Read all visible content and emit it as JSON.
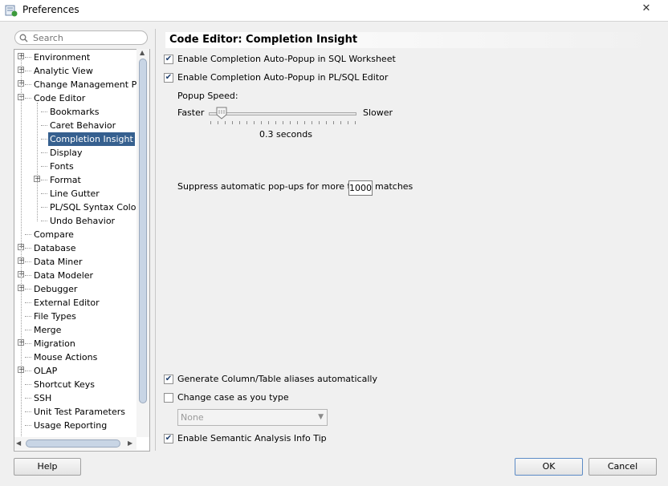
{
  "window": {
    "title": "Preferences",
    "close_label": "✕"
  },
  "search": {
    "placeholder": "Search"
  },
  "tree": {
    "items": [
      {
        "label": "Environment",
        "expandable": true,
        "level": 0
      },
      {
        "label": "Analytic View",
        "expandable": true,
        "level": 0
      },
      {
        "label": "Change Management Parar",
        "expandable": true,
        "level": 0
      },
      {
        "label": "Code Editor",
        "expandable": true,
        "expanded": true,
        "level": 0
      },
      {
        "label": "Bookmarks",
        "level": 1
      },
      {
        "label": "Caret Behavior",
        "level": 1
      },
      {
        "label": "Completion Insight",
        "level": 1,
        "selected": true
      },
      {
        "label": "Display",
        "level": 1
      },
      {
        "label": "Fonts",
        "level": 1
      },
      {
        "label": "Format",
        "expandable": true,
        "level": 1
      },
      {
        "label": "Line Gutter",
        "level": 1
      },
      {
        "label": "PL/SQL Syntax Colors",
        "level": 1
      },
      {
        "label": "Undo Behavior",
        "level": 1
      },
      {
        "label": "Compare",
        "level": 0
      },
      {
        "label": "Database",
        "expandable": true,
        "level": 0
      },
      {
        "label": "Data Miner",
        "expandable": true,
        "level": 0
      },
      {
        "label": "Data Modeler",
        "expandable": true,
        "level": 0
      },
      {
        "label": "Debugger",
        "expandable": true,
        "level": 0
      },
      {
        "label": "External Editor",
        "level": 0
      },
      {
        "label": "File Types",
        "level": 0
      },
      {
        "label": "Merge",
        "level": 0
      },
      {
        "label": "Migration",
        "expandable": true,
        "level": 0
      },
      {
        "label": "Mouse Actions",
        "level": 0
      },
      {
        "label": "OLAP",
        "expandable": true,
        "level": 0
      },
      {
        "label": "Shortcut Keys",
        "level": 0
      },
      {
        "label": "SSH",
        "level": 0
      },
      {
        "label": "Unit Test Parameters",
        "level": 0
      },
      {
        "label": "Usage Reporting",
        "level": 0
      }
    ]
  },
  "panel": {
    "heading": "Code Editor: Completion Insight",
    "opt_sql_worksheet": {
      "label": "Enable Completion Auto-Popup in SQL Worksheet",
      "checked": true
    },
    "opt_plsql_editor": {
      "label": "Enable Completion Auto-Popup in PL/SQL Editor",
      "checked": true
    },
    "popup_speed_label": "Popup Speed:",
    "faster_label": "Faster",
    "slower_label": "Slower",
    "speed_value": "0.3 seconds",
    "speed_fraction": 0.05,
    "suppress_label": "Suppress automatic pop-ups for more than",
    "suppress_value": "1000",
    "suppress_suffix": "matches",
    "opt_aliases": {
      "label": "Generate Column/Table aliases automatically",
      "checked": true
    },
    "opt_change_case": {
      "label": "Change case as you type",
      "checked": false
    },
    "case_select_value": "None",
    "opt_semantic": {
      "label": "Enable Semantic Analysis Info Tip",
      "checked": true
    }
  },
  "buttons": {
    "help": "Help",
    "ok": "OK",
    "cancel": "Cancel"
  },
  "colors": {
    "selection": "#36608f",
    "check": "#1f3f6e"
  }
}
